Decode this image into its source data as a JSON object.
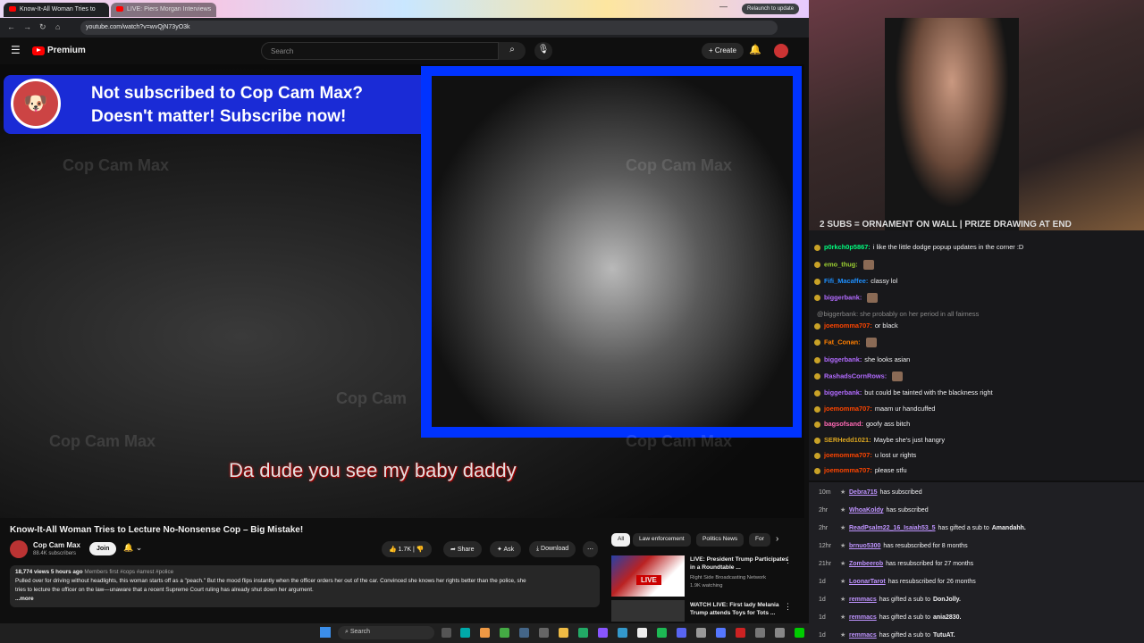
{
  "browser": {
    "tabs": [
      {
        "label": "Know-It-All Woman Tries to"
      },
      {
        "label": "LIVE: Piers Morgan Interviews"
      }
    ],
    "url": "youtube.com/watch?v=wvQjN73yO3k",
    "relaunch": "Relaunch to update"
  },
  "youtube": {
    "logo": "Premium",
    "search_placeholder": "Search",
    "create": "Create"
  },
  "video": {
    "banner_line1": "Not subscribed to Cop Cam Max?",
    "banner_line2": "Doesn't matter!   Subscribe now!",
    "subtitle": "Da dude you see my baby daddy",
    "watermark": "Cop Cam Max",
    "watermark2": "Cop Cam"
  },
  "info": {
    "title": "Know-It-All Woman Tries to Lecture No-Nonsense Cop – Big Mistake!",
    "channel": "Cop Cam Max",
    "subs": "88.4K subscribers",
    "join": "Join",
    "likes": "1.7K",
    "share": "Share",
    "ask": "Ask",
    "download": "Download",
    "desc_meta": "18,774 views  5 hours ago",
    "desc_tags": "Members first  #cops #arrest #police",
    "desc_line1": "Pulled over for driving without headlights, this woman starts off as a \"peach.\"  But the mood flips instantly when the officer orders her out of the car. Convinced she knows her rights better than the police, she",
    "desc_line2": "tries to lecture the officer on the law—unaware that a recent Supreme Court ruling has already shut down her argument.",
    "more": "...more"
  },
  "recs": {
    "chips": [
      "All",
      "Law enforcement",
      "Politics News",
      "For"
    ],
    "items": [
      {
        "title": "LIVE: President Trump Participates in a Roundtable ...",
        "channel": "Right Side Broadcasting Network",
        "meta": "1.9K watching",
        "badge": "LIVE"
      },
      {
        "title": "WATCH LIVE: First lady Melania Trump attends Toys for Tots ..."
      }
    ]
  },
  "stream": {
    "marquee": "2 SUBS = ORNAMENT ON WALL | PRIZE DRAWING AT END",
    "chat": [
      {
        "user": "p0rkch0p5867:",
        "text": "i like the little dodge popup updates in the corner :D",
        "color": "#00ff7f"
      },
      {
        "user": "emo_thug:",
        "text": "",
        "color": "#9acd32"
      },
      {
        "user": "Fifi_Macaffee:",
        "text": "classy lol",
        "color": "#1e90ff"
      },
      {
        "user": "biggerbank:",
        "text": "",
        "color": "#b26bff"
      },
      {
        "user": "",
        "text": "@biggerbank: she probably on her period in all fairness",
        "color": "#888"
      },
      {
        "user": "joemomma707:",
        "text": "or black",
        "color": "#ff4500"
      },
      {
        "user": "Fat_Conan:",
        "text": "",
        "color": "#ff7f00"
      },
      {
        "user": "biggerbank:",
        "text": "she looks asian",
        "color": "#b26bff"
      },
      {
        "user": "RashadsCornRows:",
        "text": "",
        "color": "#b26bff"
      },
      {
        "user": "biggerbank:",
        "text": "but could be tainted with the blackness right",
        "color": "#b26bff"
      },
      {
        "user": "joemomma707:",
        "text": "maam ur handcuffed",
        "color": "#ff4500"
      },
      {
        "user": "bagsofsand:",
        "text": "goofy ass bitch",
        "color": "#ff69b4"
      },
      {
        "user": "SERHedd1021:",
        "text": "Maybe she's just hangry",
        "color": "#daa520"
      },
      {
        "user": "joemomma707:",
        "text": "u lost ur rights",
        "color": "#ff4500"
      },
      {
        "user": "joemomma707:",
        "text": "please stfu",
        "color": "#ff4500"
      }
    ],
    "events": [
      {
        "time": "10m",
        "name": "Debra715",
        "text": "has subscribed",
        "extra": ""
      },
      {
        "time": "2hr",
        "name": "WhoaKoldy",
        "text": "has subscribed",
        "extra": ""
      },
      {
        "time": "2hr",
        "name": "ReadPsalm22_16_Isaiah53_5",
        "text": "has gifted a sub to",
        "extra": "Amandahh."
      },
      {
        "time": "12hr",
        "name": "brnuo5300",
        "text": "has resubscribed for 8 months",
        "extra": ""
      },
      {
        "time": "21hr",
        "name": "Zombeerob",
        "text": "has resubscribed for 27 months",
        "extra": ""
      },
      {
        "time": "1d",
        "name": "LoonarTarot",
        "text": "has resubscribed for 26 months",
        "extra": ""
      },
      {
        "time": "1d",
        "name": "remmacs",
        "text": "has gifted a sub to",
        "extra": "DonJolly."
      },
      {
        "time": "1d",
        "name": "remmacs",
        "text": "has gifted a sub to",
        "extra": "ania2830."
      },
      {
        "time": "1d",
        "name": "remmacs",
        "text": "has gifted a sub to",
        "extra": "TutuAT."
      }
    ]
  },
  "taskbar": {
    "search": "Search"
  }
}
